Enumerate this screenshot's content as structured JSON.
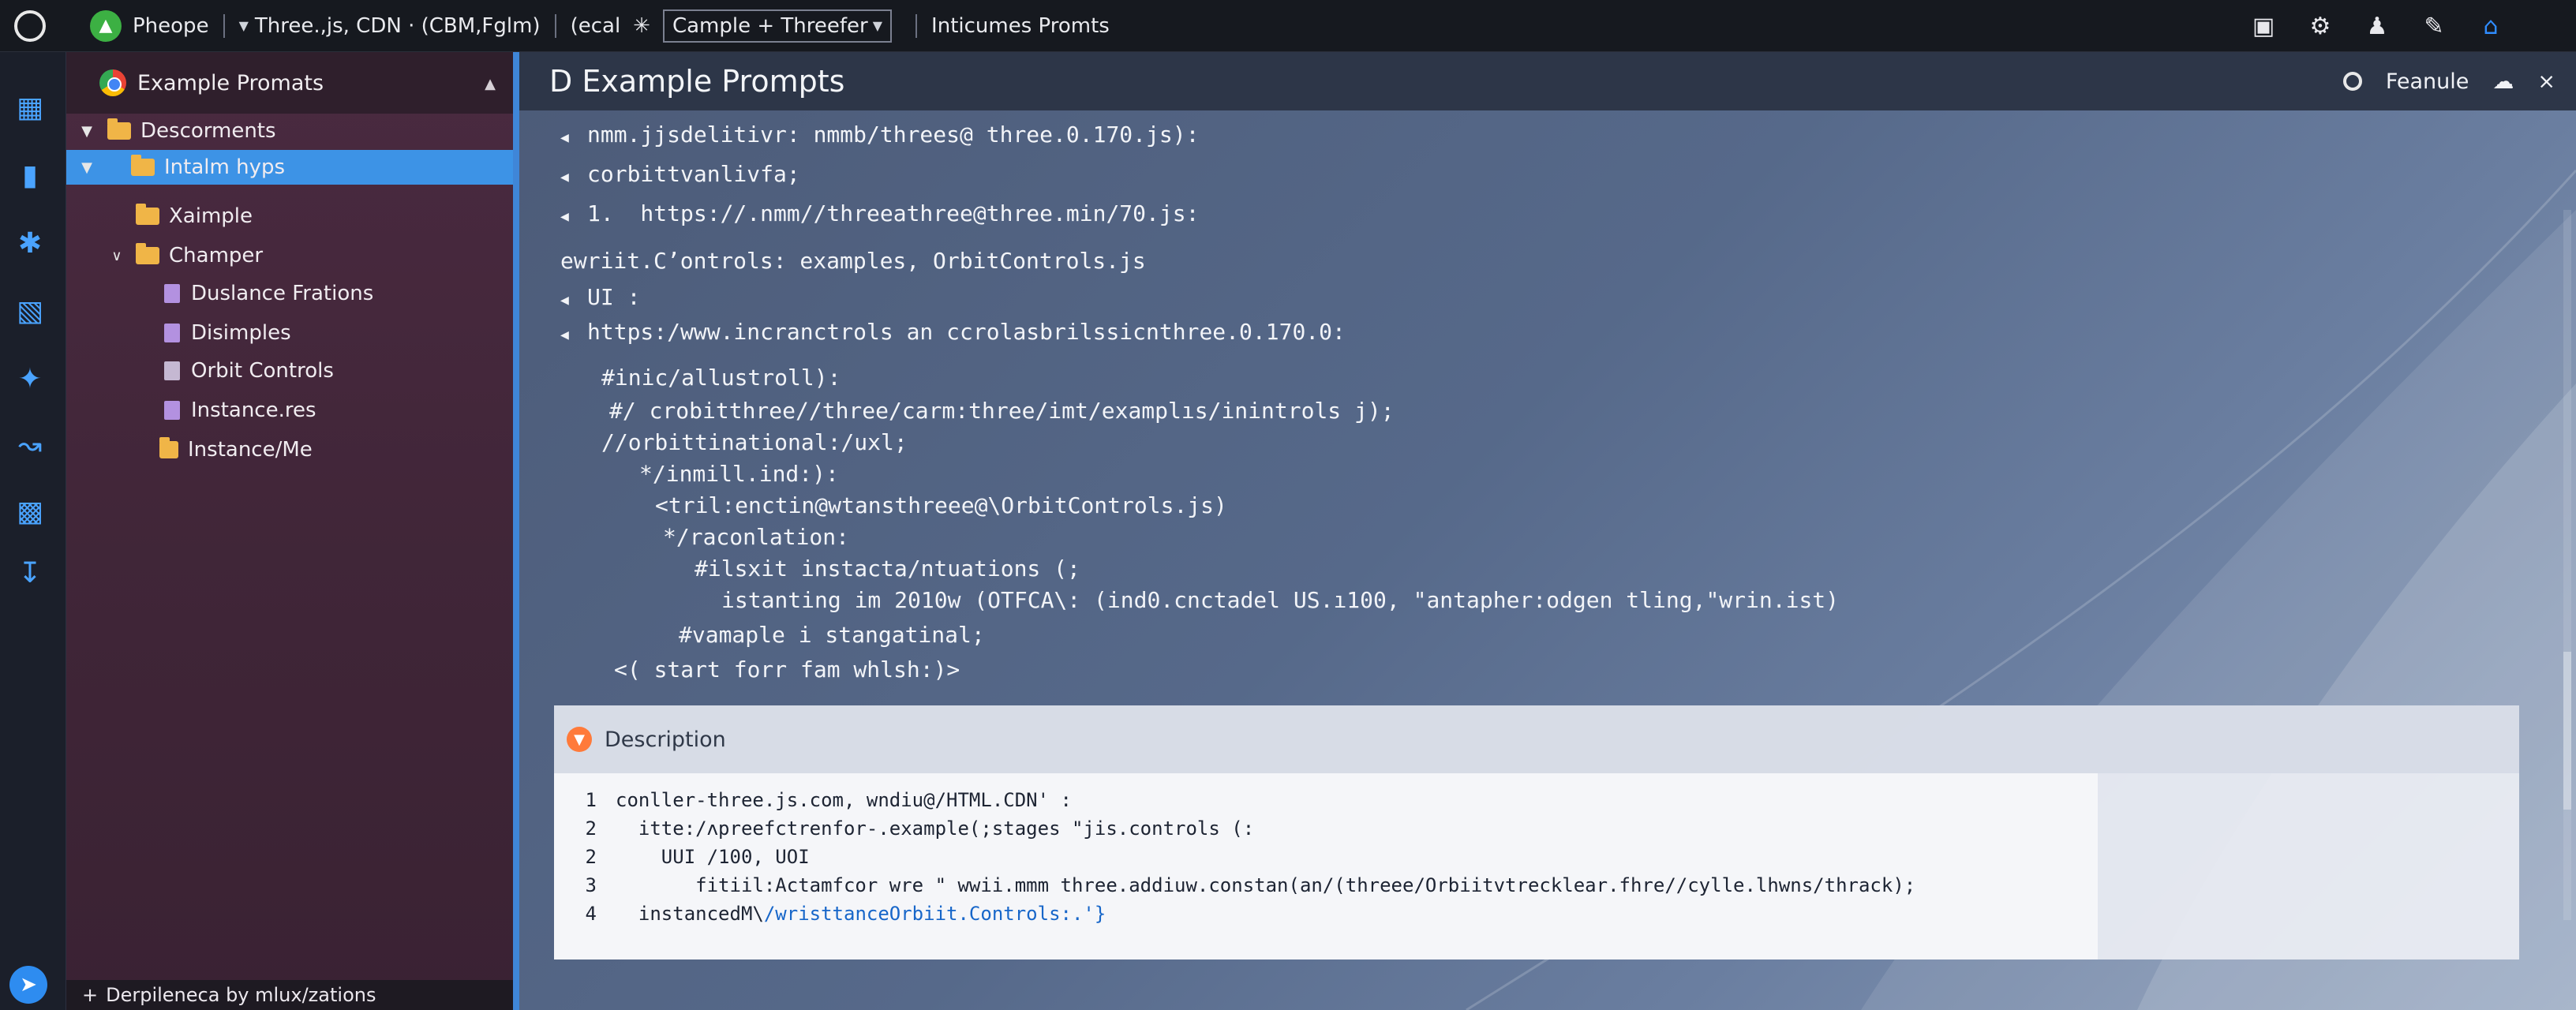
{
  "topbar": {
    "app_label": "Pheope",
    "tab_1": "Three.,js, CDN · (CBM,Fglm)",
    "tab_2": "(ecal",
    "tab_3_star": "✳",
    "tab_3": "Cample + Threefer",
    "tab_4": "Inticumes Promts",
    "icons": [
      "dashboard-icon",
      "settings-icon",
      "user-icon",
      "notes-icon",
      "home-icon"
    ]
  },
  "rail": {
    "icons": [
      "explorer-icon",
      "folders-icon",
      "tools-icon",
      "panel-icon",
      "extensions-icon",
      "graph-icon",
      "blocks-icon",
      "download-icon",
      "send-icon"
    ]
  },
  "sidebar": {
    "title": "Example Promats",
    "items": [
      {
        "label": "Descorments",
        "kind": "folder",
        "expanded": true
      },
      {
        "label": "Intalm hyps",
        "kind": "folder",
        "expanded": true,
        "selected": true
      },
      {
        "label": "Xaimple",
        "kind": "folder"
      },
      {
        "label": "Champer",
        "kind": "folder",
        "expanded": true
      },
      {
        "label": "Duslance Frations",
        "kind": "file"
      },
      {
        "label": "Disimples",
        "kind": "file"
      },
      {
        "label": "Orbit Controls",
        "kind": "file"
      },
      {
        "label": "Instance.res",
        "kind": "file"
      },
      {
        "label": "Instance/Me",
        "kind": "folder"
      }
    ],
    "footer": "Derpileneca by mlux/zations",
    "footer_plus": "+"
  },
  "editor": {
    "title": "Example Prompts",
    "title_prefix": "D",
    "right_label": "Feanule",
    "close_label": "×",
    "lines": [
      "nmm.jjsdelitivr: nmmb/threes@ three.0.170.js):",
      "corbittvanlivfa;",
      "1.  https:∕/.nmm//threeathree@three.min/70.js:",
      "ewriit.C’ontrols: examples, OrbitControls.js",
      "UI :",
      "https:/www.incranctrols an ccrolasbrilssicnthree.0.170.0:",
      "#inic/allustroll):",
      "#/ crobitthree∕/three/carm:three/imt/examplıs/inintrols j);",
      "//orbittinational:/uxl;",
      "*/inmill.ind:):",
      "<tril:enctin@wtansthreee@\\OrbitControls.js)",
      "*/raconlation:",
      "#ilsxit instacta/ntuations (;",
      "istanting im 2010w (OTFCA\\: (ind0.cnctadel US.ı100, \"antapher:odgen tling,\"wrin.ist)",
      "#vamaple i stangatinal;",
      "<( start forr fam whlsh:)>"
    ]
  },
  "description": {
    "title": "Description",
    "lines": [
      {
        "num": "1",
        "text": "conller-three.js.com, wndiu@/HTML.CDN' :",
        "blue": ""
      },
      {
        "num": "2",
        "text": "  itte:/ʌpreefctrenfor-.example(;stages \"jis.controls (:",
        "blue": ""
      },
      {
        "num": "2",
        "text": "    UUI /100, UOI",
        "blue": ""
      },
      {
        "num": "3",
        "text": "       fitiil:Actamfcor wre \" wwii.mmm three.addiuw.constan(an/(threee/Orbiitvtrecklear.fhre//cylle.lhwns/thrack);",
        "blue": ""
      },
      {
        "num": "4",
        "text": "  instancedM\\",
        "blue": "/wristtanceOrbiit.Controls:.'}"
      }
    ]
  }
}
